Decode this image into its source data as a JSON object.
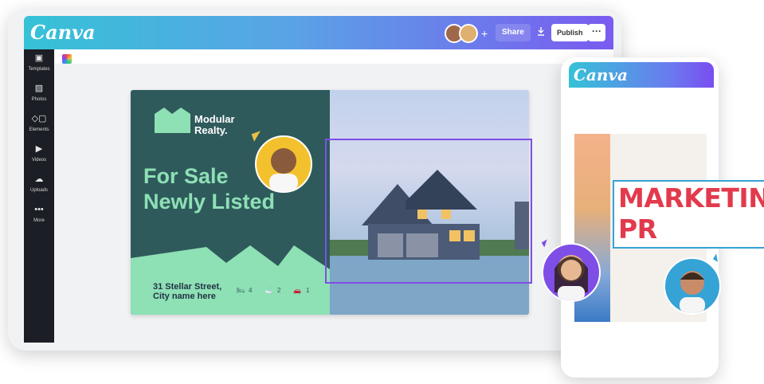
{
  "editor": {
    "logo": "Canva",
    "toolbar": {
      "share_label": "Share",
      "download_icon": "download-icon",
      "publish_label": "Publish",
      "more_label": "···"
    },
    "sidebar": {
      "items": [
        {
          "icon": "templates-icon",
          "label": "Templates"
        },
        {
          "icon": "photos-icon",
          "label": "Photos"
        },
        {
          "icon": "elements-icon",
          "label": "Elements"
        },
        {
          "icon": "videos-icon",
          "label": "Videos"
        },
        {
          "icon": "uploads-icon",
          "label": "Uploads"
        },
        {
          "icon": "more-icon",
          "label": "More"
        }
      ]
    }
  },
  "design": {
    "brand_line1": "Modular",
    "brand_line2": "Realty.",
    "headline_line1": "For Sale",
    "headline_line2": "Newly Listed",
    "address_line1": "31 Stellar Street,",
    "address_line2": "City name here",
    "features": [
      {
        "icon": "bed-icon",
        "value": "4"
      },
      {
        "icon": "bath-icon",
        "value": "2"
      },
      {
        "icon": "car-icon",
        "value": "1"
      }
    ],
    "colors": {
      "dark": "#2f5a5c",
      "mint": "#8ee0b5",
      "selection": "#7f4ee6"
    }
  },
  "mobile": {
    "logo": "Canva",
    "marketing_line1": "MARKETING",
    "marketing_line2": "PR",
    "colors": {
      "accent": "#e23a4c",
      "border": "#35a3d6"
    }
  }
}
